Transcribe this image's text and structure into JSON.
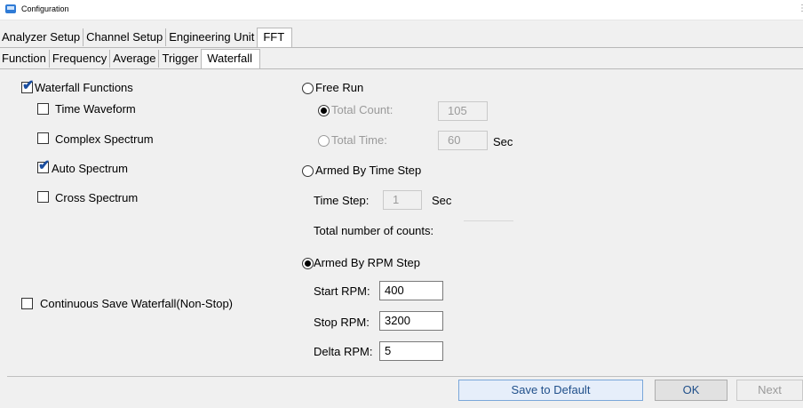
{
  "window": {
    "title": "Configuration",
    "more_indicator": "⋮"
  },
  "tabs_row1": [
    {
      "label": "Analyzer Setup",
      "active": false
    },
    {
      "label": "Channel Setup",
      "active": false
    },
    {
      "label": "Engineering Unit",
      "active": false
    },
    {
      "label": "FFT",
      "active": true
    }
  ],
  "tabs_row2": [
    {
      "label": "Function",
      "active": false
    },
    {
      "label": "Frequency",
      "active": false
    },
    {
      "label": "Average",
      "active": false
    },
    {
      "label": "Trigger",
      "active": false
    },
    {
      "label": "Waterfall",
      "active": true
    }
  ],
  "left": {
    "waterfall_functions": {
      "label": "Waterfall Functions",
      "checked": true
    },
    "time_waveform": {
      "label": "Time Waveform",
      "checked": false
    },
    "complex_spectrum": {
      "label": "Complex Spectrum",
      "checked": false
    },
    "auto_spectrum": {
      "label": "Auto Spectrum",
      "checked": true
    },
    "cross_spectrum": {
      "label": "Cross Spectrum",
      "checked": false
    },
    "continuous_save": {
      "label": "Continuous Save Waterfall(Non-Stop)",
      "checked": false
    }
  },
  "right": {
    "free_run": {
      "label": "Free Run",
      "selected": false
    },
    "total_count": {
      "label": "Total Count:",
      "value": "105",
      "selected": true
    },
    "total_time": {
      "label": "Total Time:",
      "value": "60",
      "unit": "Sec",
      "selected": false
    },
    "armed_time": {
      "label": "Armed By Time Step",
      "selected": false
    },
    "time_step": {
      "label": "Time Step:",
      "value": "1",
      "unit": "Sec"
    },
    "total_counts": {
      "label": "Total number of counts:",
      "value": ""
    },
    "armed_rpm": {
      "label": "Armed By RPM Step",
      "selected": true
    },
    "start_rpm": {
      "label": "Start RPM:",
      "value": "400"
    },
    "stop_rpm": {
      "label": "Stop RPM:",
      "value": "3200"
    },
    "delta_rpm": {
      "label": "Delta RPM:",
      "value": "5"
    }
  },
  "buttons": {
    "save_default": "Save to Default",
    "ok": "OK",
    "next": "Next"
  },
  "icons": {
    "app": "app-icon",
    "check": "✔"
  }
}
